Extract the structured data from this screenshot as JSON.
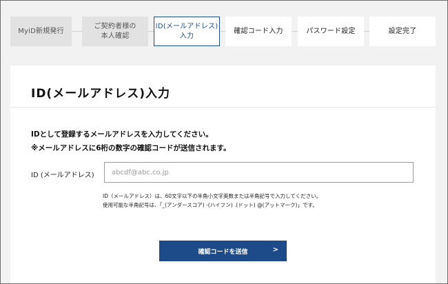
{
  "steps": [
    {
      "lines": [
        "MyiD新規発行"
      ],
      "state": "done"
    },
    {
      "lines": [
        "ご契約者様の",
        "本人確認"
      ],
      "state": "done"
    },
    {
      "lines": [
        "ID(メールアドレス)",
        "入力"
      ],
      "state": "active"
    },
    {
      "lines": [
        "確認コード入力"
      ],
      "state": "todo"
    },
    {
      "lines": [
        "パスワード設定"
      ],
      "state": "todo"
    },
    {
      "lines": [
        "設定完了"
      ],
      "state": "todo"
    }
  ],
  "card": {
    "title": "ID(メールアドレス)入力",
    "instruction_1": "IDとして登録するメールアドレスを入力してください。",
    "instruction_2": "※メールアドレスに6桁の数字の確認コードが送信されます。",
    "field_label": "ID (メールアドレス)",
    "input_value": "",
    "input_placeholder": "abcdf@abc.co.jp",
    "note_1": "ID（メールアドレス）は、60文字以下の半角小文字英数または半角記号で入力してください。",
    "note_2": "使用可能な半角記号は、「_(アンダースコア) -(ハイフン) .(ドット) @(アットマーク)」です。",
    "submit_label": "確認コードを送信",
    "submit_icon": "chevron-right-icon"
  },
  "colors": {
    "accent": "#1d4b89",
    "step_done_bg": "#e2e2e2",
    "page_bg": "#f2f2f2"
  }
}
